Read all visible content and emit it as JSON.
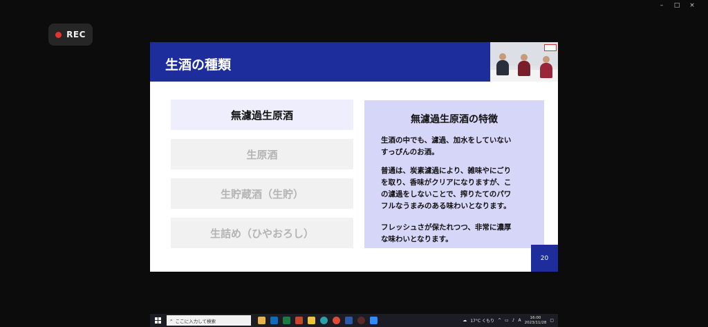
{
  "window": {
    "controls": [
      "–",
      "□",
      "×"
    ]
  },
  "recording": {
    "label": "REC"
  },
  "slide": {
    "title": "生酒の種類",
    "page_number": "20",
    "options": [
      {
        "label": "無濾過生原酒",
        "active": true
      },
      {
        "label": "生原酒",
        "active": false
      },
      {
        "label": "生貯蔵酒（生貯）",
        "active": false
      },
      {
        "label": "生詰め（ひやおろし）",
        "active": false
      }
    ],
    "info": {
      "title": "無濾過生原酒の特徴",
      "paragraphs": [
        "生酒の中でも、濾過、加水をしていない\nすっぴんのお酒。",
        "普通は、炭素濾過により、雑味やにごり\nを取り、香味がクリアになりますが、こ\nの濾過をしないことで、搾りたてのパワ\nフルなうまみのある味わいとなります。",
        "フレッシュさが保たれつつ、非常に濃厚\nな味わいとなります。"
      ]
    }
  },
  "taskbar": {
    "search_placeholder": "ここに入力して検索",
    "weather": "17°C くもり",
    "ime": "A",
    "time": "16:00",
    "date": "2023/11/28",
    "apps": [
      "folder",
      "outlook",
      "excel",
      "powerpoint",
      "explorer",
      "edge",
      "chrome",
      "word",
      "media",
      "zoom"
    ]
  },
  "colors": {
    "accent": "#1d2d9c",
    "info_bg": "#d6d7f8",
    "active_option_bg": "#eeeefc",
    "inactive_option_bg": "#f1f1f1"
  }
}
